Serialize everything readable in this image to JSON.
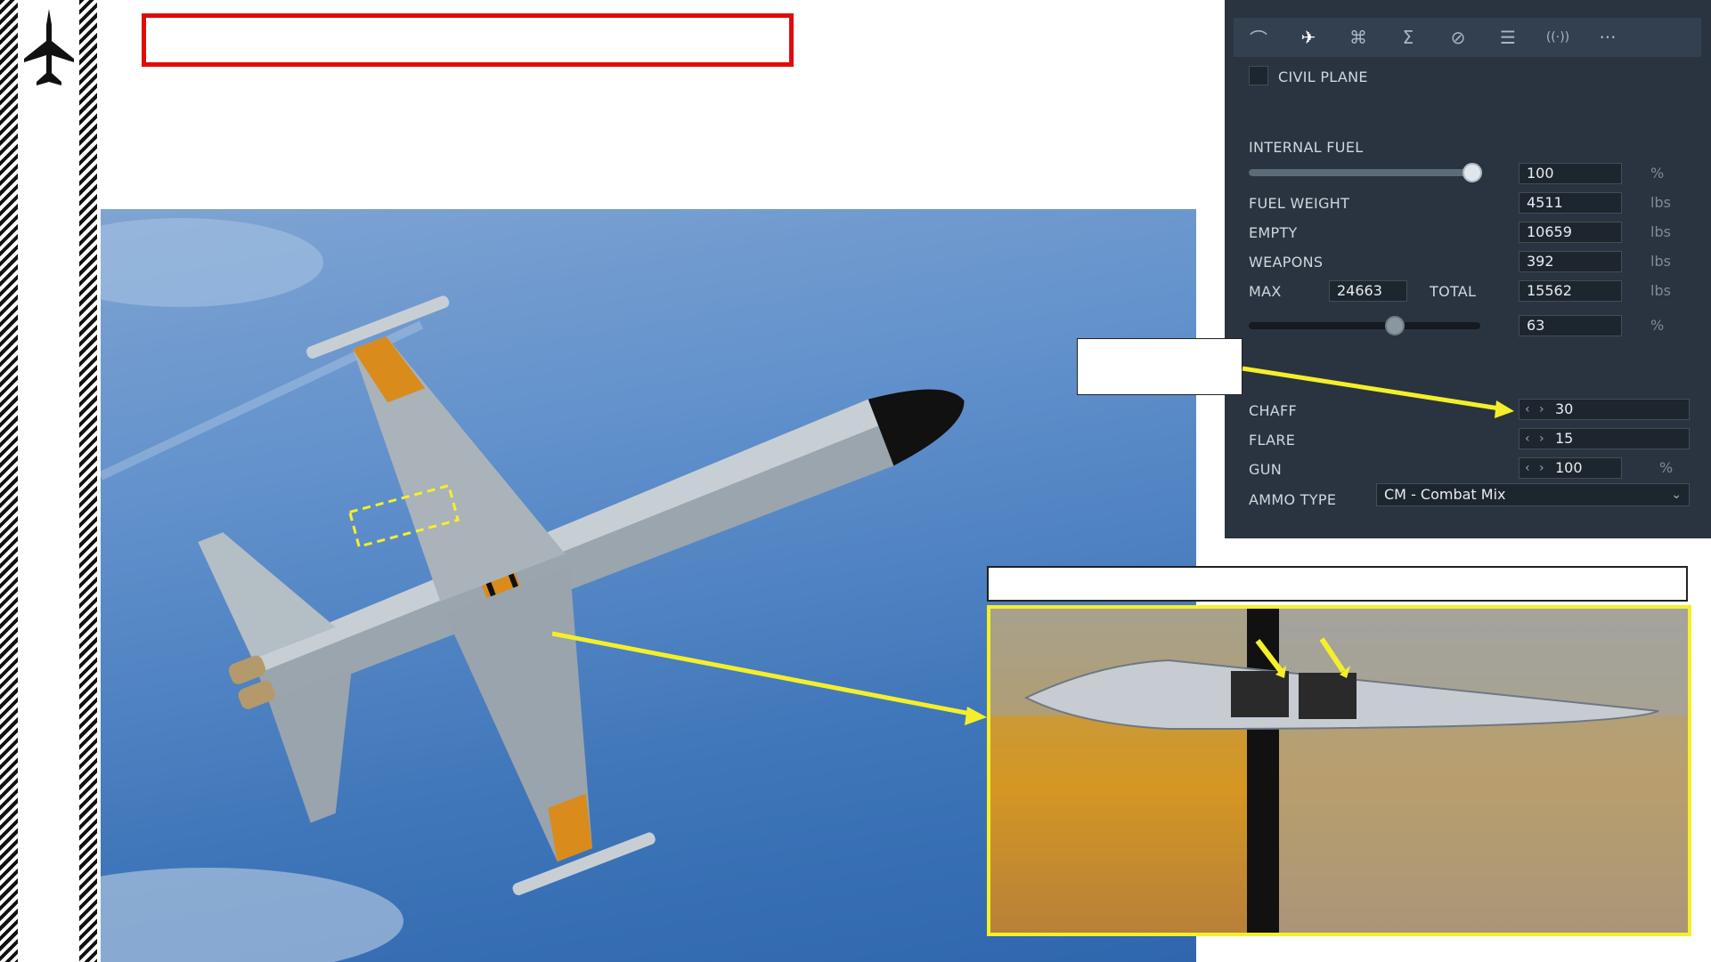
{
  "title_box": {
    "text": ""
  },
  "callout": {
    "text": ""
  },
  "caption": {
    "text": ""
  },
  "panel": {
    "tabs": [
      {
        "name": "flight-path",
        "glyph": "⌒"
      },
      {
        "name": "loadout",
        "glyph": "✈"
      },
      {
        "name": "command",
        "glyph": "⌘"
      },
      {
        "name": "summary",
        "glyph": "Σ"
      },
      {
        "name": "none",
        "glyph": "⊘"
      },
      {
        "name": "payload",
        "glyph": "☰"
      },
      {
        "name": "radio",
        "glyph": "((·))"
      },
      {
        "name": "more",
        "glyph": "···"
      }
    ],
    "civil_plane_label": "CIVIL PLANE",
    "internal_fuel_label": "INTERNAL FUEL",
    "internal_fuel_value": "100",
    "internal_fuel_unit": "%",
    "fuel_weight_label": "FUEL WEIGHT",
    "fuel_weight_value": "4511",
    "empty_label": "EMPTY",
    "empty_value": "10659",
    "weapons_label": "WEAPONS",
    "weapons_value": "392",
    "max_label": "MAX",
    "max_value": "24663",
    "total_label": "TOTAL",
    "total_value": "15562",
    "weight_unit": "lbs",
    "weight_pct_value": "63",
    "weight_pct_unit": "%",
    "chaff_label": "CHAFF",
    "chaff_value": "30",
    "flare_label": "FLARE",
    "flare_value": "15",
    "gun_label": "GUN",
    "gun_value": "100",
    "gun_unit": "%",
    "ammo_type_label": "AMMO TYPE",
    "ammo_type_value": "CM - Combat Mix",
    "internal_fuel_level": 1.0,
    "weight_level": 0.63
  },
  "colors": {
    "title_border": "#e10a0a",
    "highlight_yellow": "#f5ef2a",
    "panel_bg": "#2a3440"
  }
}
